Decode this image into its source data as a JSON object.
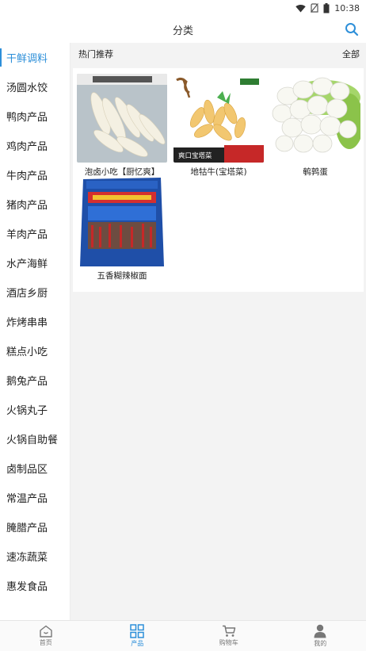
{
  "status_bar": {
    "time": "10:38",
    "icons": [
      "wifi-icon",
      "no-sim-icon",
      "battery-icon"
    ]
  },
  "header": {
    "title": "分类",
    "search_icon": "search-icon"
  },
  "sidebar": {
    "items": [
      {
        "label": "干鲜调料",
        "active": true
      },
      {
        "label": "汤圆水饺"
      },
      {
        "label": "鸭肉产品"
      },
      {
        "label": "鸡肉产品"
      },
      {
        "label": "牛肉产品"
      },
      {
        "label": "猪肉产品"
      },
      {
        "label": "羊肉产品"
      },
      {
        "label": "水产海鲜"
      },
      {
        "label": "酒店乡厨"
      },
      {
        "label": "炸烤串串"
      },
      {
        "label": "糕点小吃"
      },
      {
        "label": "鹅兔产品"
      },
      {
        "label": "火锅丸子"
      },
      {
        "label": "火锅自助餐"
      },
      {
        "label": "卤制品区"
      },
      {
        "label": "常温产品"
      },
      {
        "label": "腌腊产品"
      },
      {
        "label": "速冻蔬菜"
      },
      {
        "label": "惠发食品"
      }
    ]
  },
  "section": {
    "title": "热门推荐",
    "all_label": "全部"
  },
  "products": [
    {
      "name": "泡卤小吃【厨忆爽】"
    },
    {
      "name": "地牯牛(宝塔菜)",
      "image_text": "爽口宝塔菜"
    },
    {
      "name": "鹌鹑蛋"
    },
    {
      "name": "五香糊辣椒面"
    }
  ],
  "bottom_nav": {
    "tabs": [
      {
        "label": "首页",
        "icon": "home-icon"
      },
      {
        "label": "产品",
        "icon": "grid-icon",
        "active": true
      },
      {
        "label": "购物车",
        "icon": "cart-icon"
      },
      {
        "label": "我的",
        "icon": "user-icon"
      }
    ]
  },
  "colors": {
    "accent": "#2d8fd9",
    "content_bg": "#f3f3f3"
  }
}
